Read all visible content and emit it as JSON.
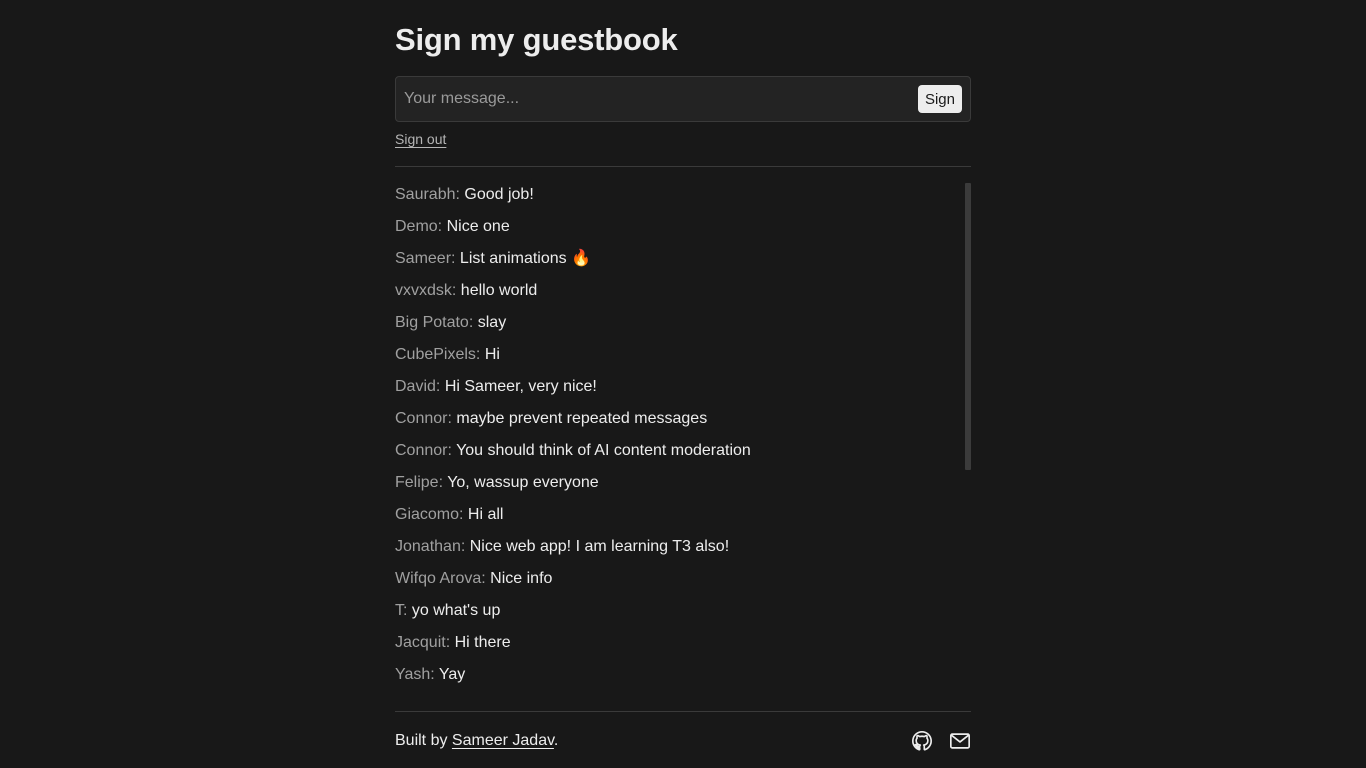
{
  "page": {
    "title": "Sign my guestbook"
  },
  "form": {
    "placeholder": "Your message...",
    "sign_label": "Sign",
    "sign_out_label": "Sign out"
  },
  "entries": [
    {
      "author": "Saurabh:",
      "message": "Good job!"
    },
    {
      "author": "Demo:",
      "message": "Nice one"
    },
    {
      "author": "Sameer:",
      "message": "List animations 🔥"
    },
    {
      "author": "vxvxdsk:",
      "message": "hello world"
    },
    {
      "author": "Big Potato:",
      "message": "slay"
    },
    {
      "author": "CubePixels:",
      "message": "Hi"
    },
    {
      "author": "David:",
      "message": "Hi Sameer, very nice!"
    },
    {
      "author": "Connor:",
      "message": "maybe prevent repeated messages"
    },
    {
      "author": "Connor:",
      "message": "You should think of AI content moderation"
    },
    {
      "author": "Felipe:",
      "message": "Yo, wassup everyone"
    },
    {
      "author": "Giacomo:",
      "message": "Hi all"
    },
    {
      "author": "Jonathan:",
      "message": "Nice web app! I am learning T3 also!"
    },
    {
      "author": "Wifqo Arova:",
      "message": "Nice info"
    },
    {
      "author": "T:",
      "message": "yo what's up"
    },
    {
      "author": "Jacquit:",
      "message": "Hi there"
    },
    {
      "author": "Yash:",
      "message": "Yay"
    }
  ],
  "footer": {
    "built_by_prefix": "Built by ",
    "author_link": "Sameer Jadav",
    "suffix": ".",
    "icons": [
      "github-icon",
      "mail-icon"
    ]
  },
  "colors": {
    "background": "#181818",
    "text": "#ededed",
    "muted": "#a0a0a0",
    "border": "#3a3a3a"
  }
}
